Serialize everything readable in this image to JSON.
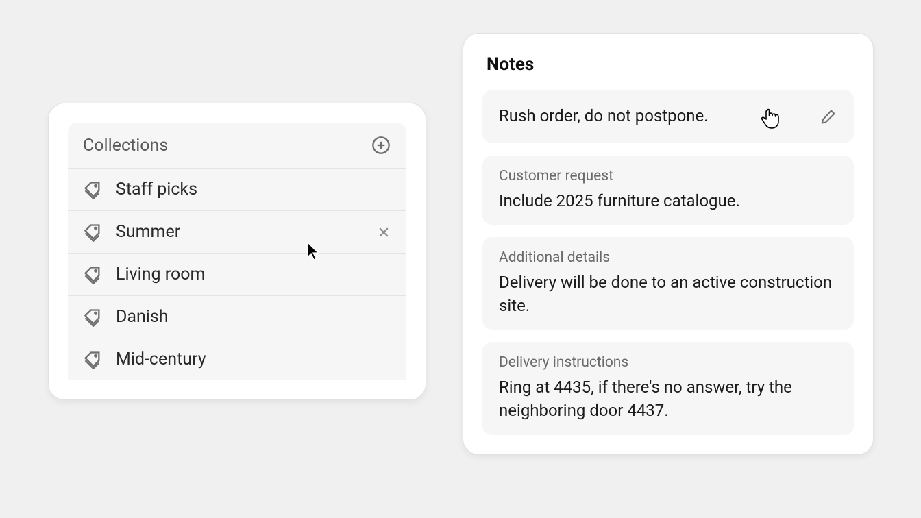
{
  "collections": {
    "title": "Collections",
    "items": [
      {
        "label": "Staff picks"
      },
      {
        "label": "Summer",
        "closable": true
      },
      {
        "label": "Living room"
      },
      {
        "label": "Danish"
      },
      {
        "label": "Mid-century"
      }
    ]
  },
  "notes": {
    "title": "Notes",
    "items": [
      {
        "label": "",
        "text": "Rush order, do not postpone.",
        "editable": true
      },
      {
        "label": "Customer request",
        "text": "Include 2025 furniture catalogue."
      },
      {
        "label": "Additional details",
        "text": "Delivery will be done to an active construction site."
      },
      {
        "label": "Delivery instructions",
        "text": "Ring at 4435, if there's no answer, try the neighboring door 4437."
      }
    ]
  }
}
